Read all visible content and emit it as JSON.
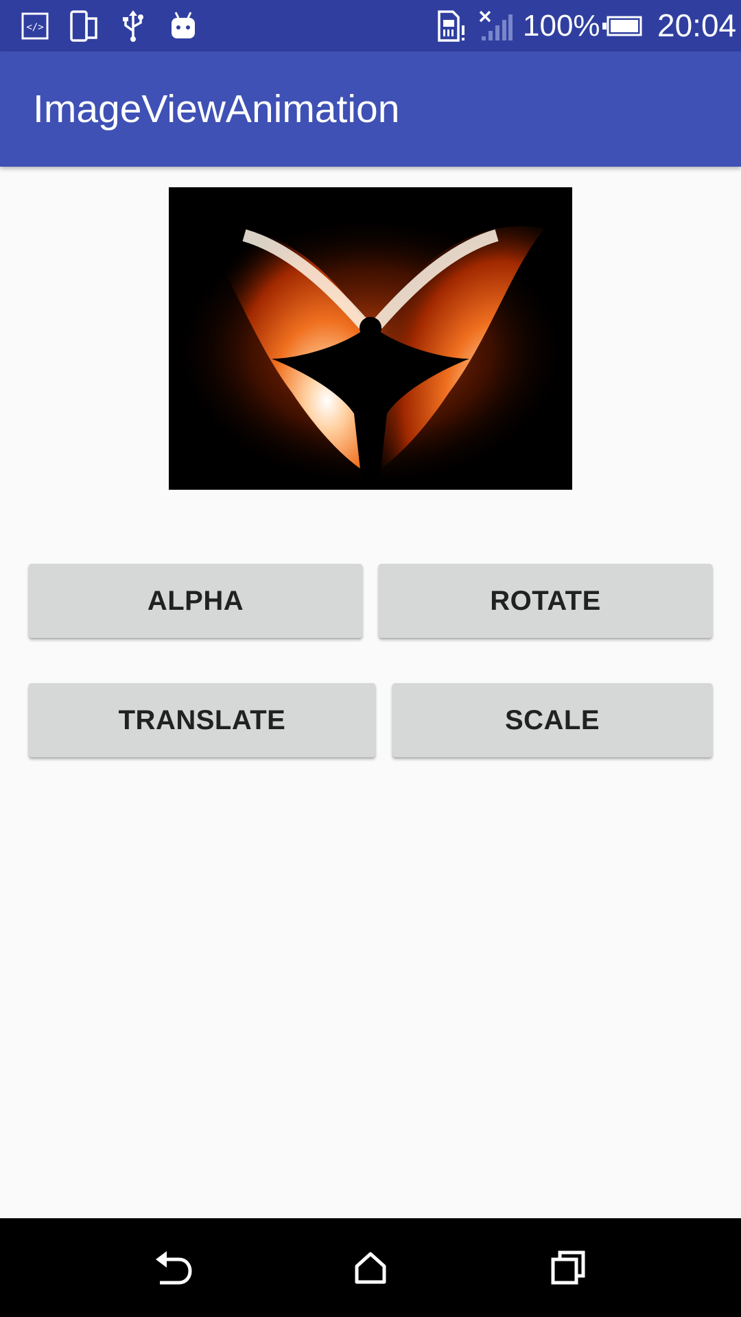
{
  "status_bar": {
    "icons": [
      "code-icon",
      "device-rotate-icon",
      "usb-icon",
      "android-debug-icon",
      "sim-alert-icon",
      "signal-no-service-icon",
      "battery-icon"
    ],
    "battery_percent": "100%",
    "time": "20:04"
  },
  "app_bar": {
    "title": "ImageViewAnimation"
  },
  "image": {
    "description_icon": "phoenix-image"
  },
  "buttons": {
    "alpha": "ALPHA",
    "rotate": "ROTATE",
    "translate": "TRANSLATE",
    "scale": "SCALE"
  },
  "nav_bar": {
    "icons": [
      "back-icon",
      "home-icon",
      "recents-icon"
    ]
  },
  "colors": {
    "status_bar": "#303f9f",
    "app_bar": "#3f51b5",
    "background": "#fafafa",
    "button": "#d6d7d7"
  }
}
